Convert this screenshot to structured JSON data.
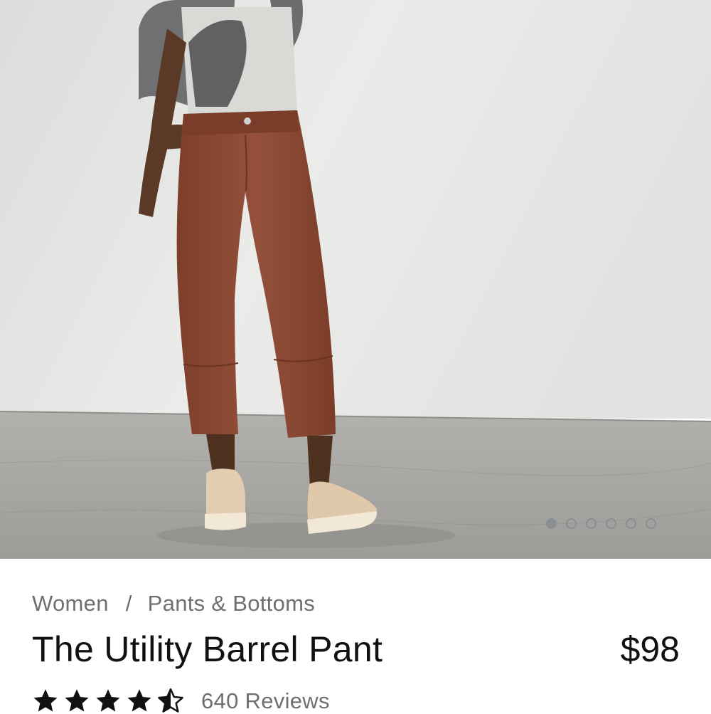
{
  "product": {
    "image": {
      "description_icon": "product-photo",
      "carousel_count": 6,
      "active_index": 0
    },
    "breadcrumb": {
      "items": [
        "Women",
        "Pants & Bottoms"
      ],
      "separator": "/"
    },
    "title": "The Utility Barrel Pant",
    "price": "$98",
    "rating": {
      "value": 4.5,
      "max": 5,
      "reviews_label": "640 Reviews"
    }
  },
  "colors": {
    "pant": "#8e4a33",
    "wall": "#e8e8e6",
    "floor": "#a9a8a5",
    "dot": "#8a8e92"
  }
}
